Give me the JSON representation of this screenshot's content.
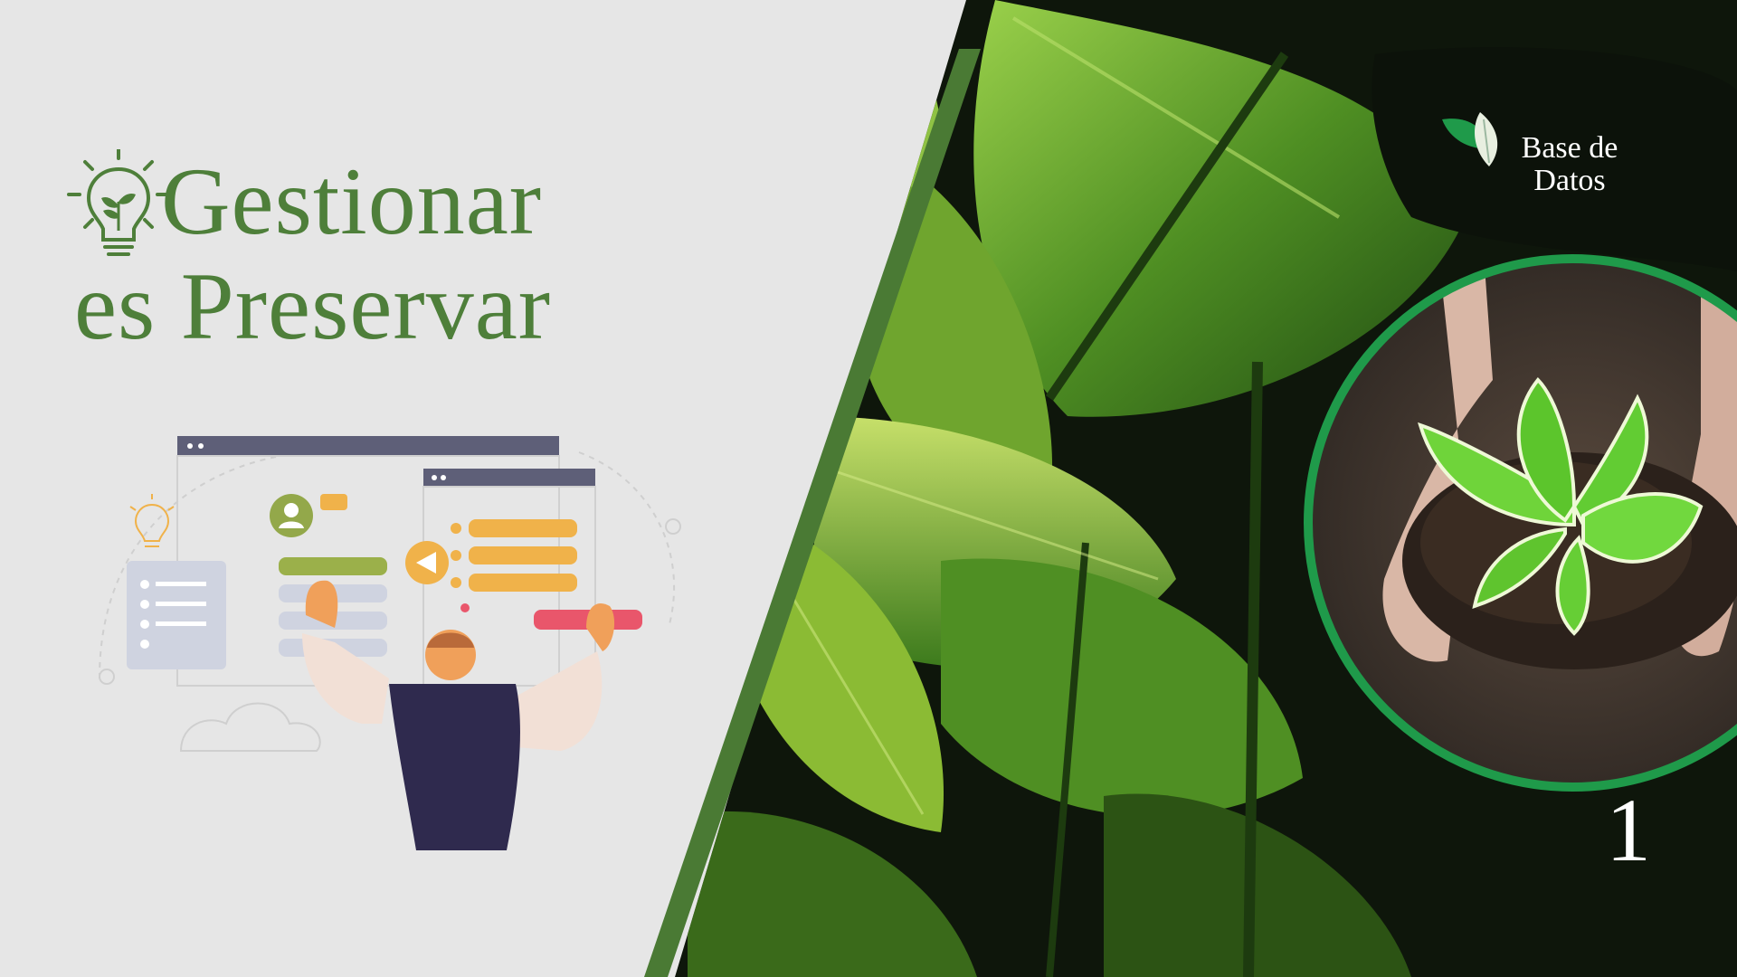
{
  "title": {
    "line1": "Gestionar",
    "line2": "es Preservar"
  },
  "brand": {
    "line1": "Base de",
    "line2": "Datos",
    "icon": "leaf-logo-icon"
  },
  "page_number": "1",
  "illustration": {
    "icon": "person-dashboard-illustration"
  },
  "colors": {
    "accent_green": "#4e7f3a",
    "stripe_green": "#4a7a34",
    "ring_green": "#1f9a4a",
    "background": "#e6e6e6",
    "dark": "#0f1a0c"
  }
}
